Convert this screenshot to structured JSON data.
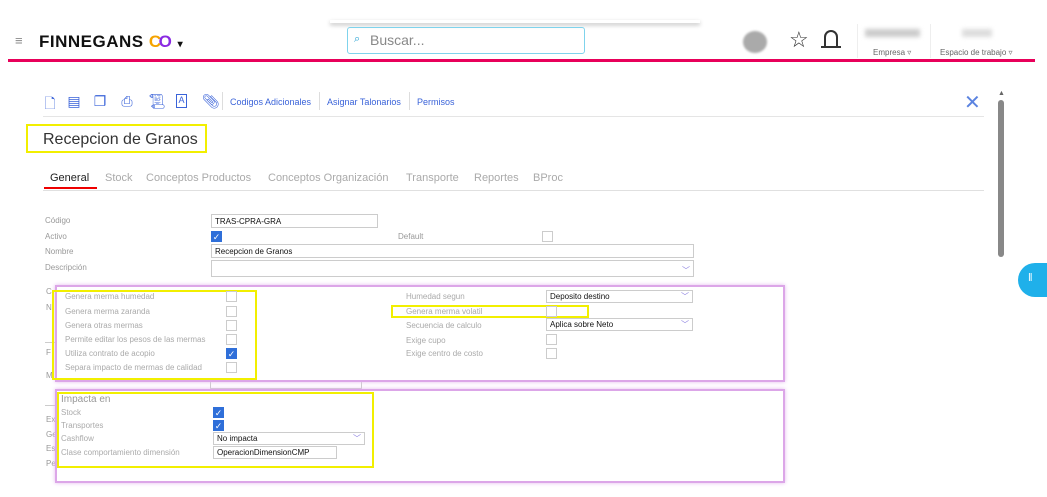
{
  "header": {
    "brand": "FINNEGANS",
    "search_placeholder": "Buscar...",
    "empresa_label": "Empresa ▿",
    "espacio_label": "Espacio de trabajo ▿",
    "accent_color": "#e8005a"
  },
  "toolbar": {
    "links": [
      "Codigos Adicionales",
      "Asignar Talonarios",
      "Permisos"
    ]
  },
  "page": {
    "title": "Recepcion de Granos"
  },
  "tabs": [
    "General",
    "Stock",
    "Conceptos Productos",
    "Conceptos Organización",
    "Transporte",
    "Reportes",
    "BProc"
  ],
  "form": {
    "codigo_label": "Código",
    "codigo_value": "TRAS-CPRA-GRA",
    "activo_label": "Activo",
    "default_label": "Default",
    "nombre_label": "Nombre",
    "nombre_value": "Recepcion de Granos",
    "descripcion_label": "Descripción",
    "descripcion_value": "",
    "hidden_fragments": [
      "C",
      "N",
      "F",
      "M",
      "Ex",
      "Ge",
      "Es",
      "Pe"
    ]
  },
  "panel1": {
    "left": [
      {
        "label": "Genera merma humedad",
        "checked": false
      },
      {
        "label": "Genera merma zaranda",
        "checked": false
      },
      {
        "label": "Genera otras mermas",
        "checked": false
      },
      {
        "label": "Permite editar los pesos de las mermas",
        "checked": false
      },
      {
        "label": "Utiliza contrato de acopio",
        "checked": true
      },
      {
        "label": "Separa impacto de mermas de calidad",
        "checked": false
      }
    ],
    "humedad_label": "Humedad segun",
    "humedad_value": "Deposito destino",
    "volatil_label": "Genera merma volatil",
    "secuencia_label": "Secuencia de calculo",
    "secuencia_value": "Aplica sobre Neto",
    "cupo_label": "Exige cupo",
    "centro_label": "Exige centro de costo"
  },
  "panel2": {
    "title": "Impacta en",
    "stock_label": "Stock",
    "transportes_label": "Transportes",
    "cashflow_label": "Cashflow",
    "cashflow_value": "No impacta",
    "clase_label": "Clase comportamiento dimensión",
    "clase_value": "OperacionDimensionCMP"
  }
}
